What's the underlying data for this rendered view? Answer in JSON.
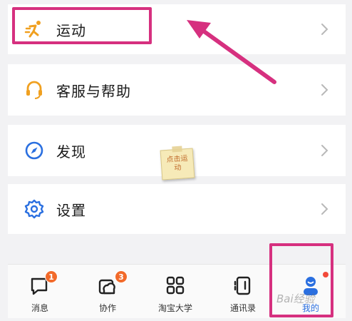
{
  "menu": [
    {
      "label": "运动",
      "icon": "running-icon",
      "icon_color": "#f0a020"
    },
    {
      "label": "客服与帮助",
      "icon": "headset-icon",
      "icon_color": "#f0a020"
    },
    {
      "label": "发现",
      "icon": "compass-icon",
      "icon_color": "#2a6fe0"
    },
    {
      "label": "设置",
      "icon": "settings-gear-icon",
      "icon_color": "#2a6fe0"
    }
  ],
  "sticky_note": {
    "line1": "点击运",
    "line2": "动"
  },
  "tabbar": [
    {
      "label": "消息",
      "icon": "message-icon",
      "badge": "1"
    },
    {
      "label": "协作",
      "icon": "collaboration-icon",
      "badge": "3"
    },
    {
      "label": "淘宝大学",
      "icon": "apps-grid-icon"
    },
    {
      "label": "通讯录",
      "icon": "contacts-book-icon"
    },
    {
      "label": "我的",
      "icon": "profile-icon",
      "active": true
    }
  ],
  "watermark": "Bai经验",
  "colors": {
    "highlight": "#d6307f",
    "accent_orange": "#f0a020",
    "accent_blue": "#2a6fe0",
    "badge": "#f26a2a"
  }
}
